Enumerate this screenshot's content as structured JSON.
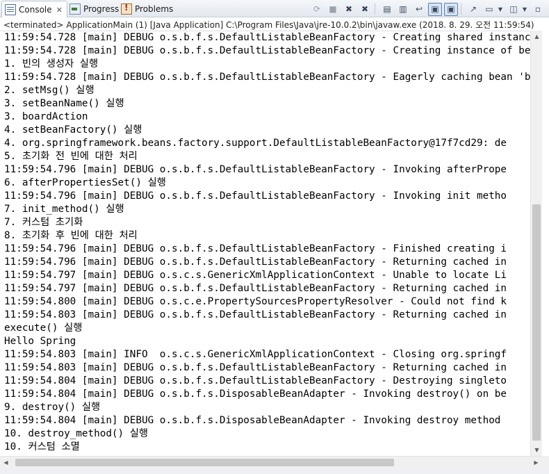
{
  "tabs": [
    {
      "label": "Console",
      "icon": "console-icon",
      "active": true,
      "close": "✕"
    },
    {
      "label": "Progress",
      "icon": "progress-icon",
      "active": false
    },
    {
      "label": "Problems",
      "icon": "problems-icon",
      "active": false
    }
  ],
  "toolbar": [
    {
      "icon": "remove-launch-icon",
      "glyph": "⟳",
      "state": "disabled"
    },
    {
      "icon": "terminate-icon",
      "glyph": "■",
      "state": "disabled"
    },
    {
      "icon": "remove-all-terminated-icon",
      "glyph": "✖",
      "state": "normal"
    },
    {
      "icon": "remove-all-icon",
      "glyph": "✖",
      "state": "normal"
    },
    {
      "icon": "clear-console-icon",
      "glyph": "▤",
      "state": "normal"
    },
    {
      "icon": "scroll-lock-icon",
      "glyph": "▥",
      "state": "normal"
    },
    {
      "icon": "word-wrap-icon",
      "glyph": "↩",
      "state": "normal"
    },
    {
      "icon": "show-on-stdout-icon",
      "glyph": "▣",
      "state": "pressed"
    },
    {
      "icon": "show-on-stderr-icon",
      "glyph": "▣",
      "state": "pressed"
    },
    {
      "icon": "pin-console-icon",
      "glyph": "↗",
      "state": "normal"
    },
    {
      "icon": "display-console-icon",
      "glyph": "▭",
      "state": "normal"
    },
    {
      "icon": "open-console-icon",
      "glyph": "◫",
      "state": "normal"
    },
    {
      "icon": "minimize-icon",
      "glyph": "▫",
      "state": "normal"
    }
  ],
  "status": "<terminated> ApplicationMain (1) [Java Application] C:\\Program Files\\Java\\jre-10.0.2\\bin\\javaw.exe (2018. 8. 29. 오전 11:59:54)",
  "console_lines": [
    "11:59:54.728 [main] DEBUG o.s.b.f.s.DefaultListableBeanFactory - Creating shared instance of singleton bean 'boardAction'",
    "11:59:54.728 [main] DEBUG o.s.b.f.s.DefaultListableBeanFactory - Creating instance of bean 'boardAction'",
    "1. 빈의 생성자 실행",
    "11:59:54.728 [main] DEBUG o.s.b.f.s.DefaultListableBeanFactory - Eagerly caching bean 'boardAction'",
    "2. setMsg() 실행",
    "3. setBeanName() 실행",
    "3. boardAction",
    "4. setBeanFactory() 실행",
    "4. org.springframework.beans.factory.support.DefaultListableBeanFactory@17f7cd29: de",
    "5. 초기화 전 빈에 대한 처리",
    "11:59:54.796 [main] DEBUG o.s.b.f.s.DefaultListableBeanFactory - Invoking afterPrope",
    "6. afterPropertiesSet() 실행",
    "11:59:54.796 [main] DEBUG o.s.b.f.s.DefaultListableBeanFactory - Invoking init metho",
    "7. init_method() 실행",
    "7. 커스텀 초기화",
    "8. 초기화 후 빈에 대한 처리",
    "11:59:54.796 [main] DEBUG o.s.b.f.s.DefaultListableBeanFactory - Finished creating i",
    "11:59:54.796 [main] DEBUG o.s.b.f.s.DefaultListableBeanFactory - Returning cached in",
    "11:59:54.797 [main] DEBUG o.s.c.s.GenericXmlApplicationContext - Unable to locate Li",
    "11:59:54.797 [main] DEBUG o.s.b.f.s.DefaultListableBeanFactory - Returning cached in",
    "11:59:54.800 [main] DEBUG o.s.c.e.PropertySourcesPropertyResolver - Could not find k",
    "11:59:54.803 [main] DEBUG o.s.b.f.s.DefaultListableBeanFactory - Returning cached in",
    "execute() 실행",
    "Hello Spring",
    "11:59:54.803 [main] INFO  o.s.c.s.GenericXmlApplicationContext - Closing org.springf",
    "11:59:54.803 [main] DEBUG o.s.b.f.s.DefaultListableBeanFactory - Returning cached in",
    "11:59:54.804 [main] DEBUG o.s.b.f.s.DefaultListableBeanFactory - Destroying singleto",
    "11:59:54.804 [main] DEBUG o.s.b.f.s.DisposableBeanAdapter - Invoking destroy() on be",
    "9. destroy() 실행",
    "11:59:54.804 [main] DEBUG o.s.b.f.s.DisposableBeanAdapter - Invoking destroy method",
    "10. destroy_method() 실행",
    "10. 커스텀 소멸"
  ],
  "scroll": {
    "up": "▲",
    "down": "▼",
    "left": "◀",
    "right": "▶"
  }
}
